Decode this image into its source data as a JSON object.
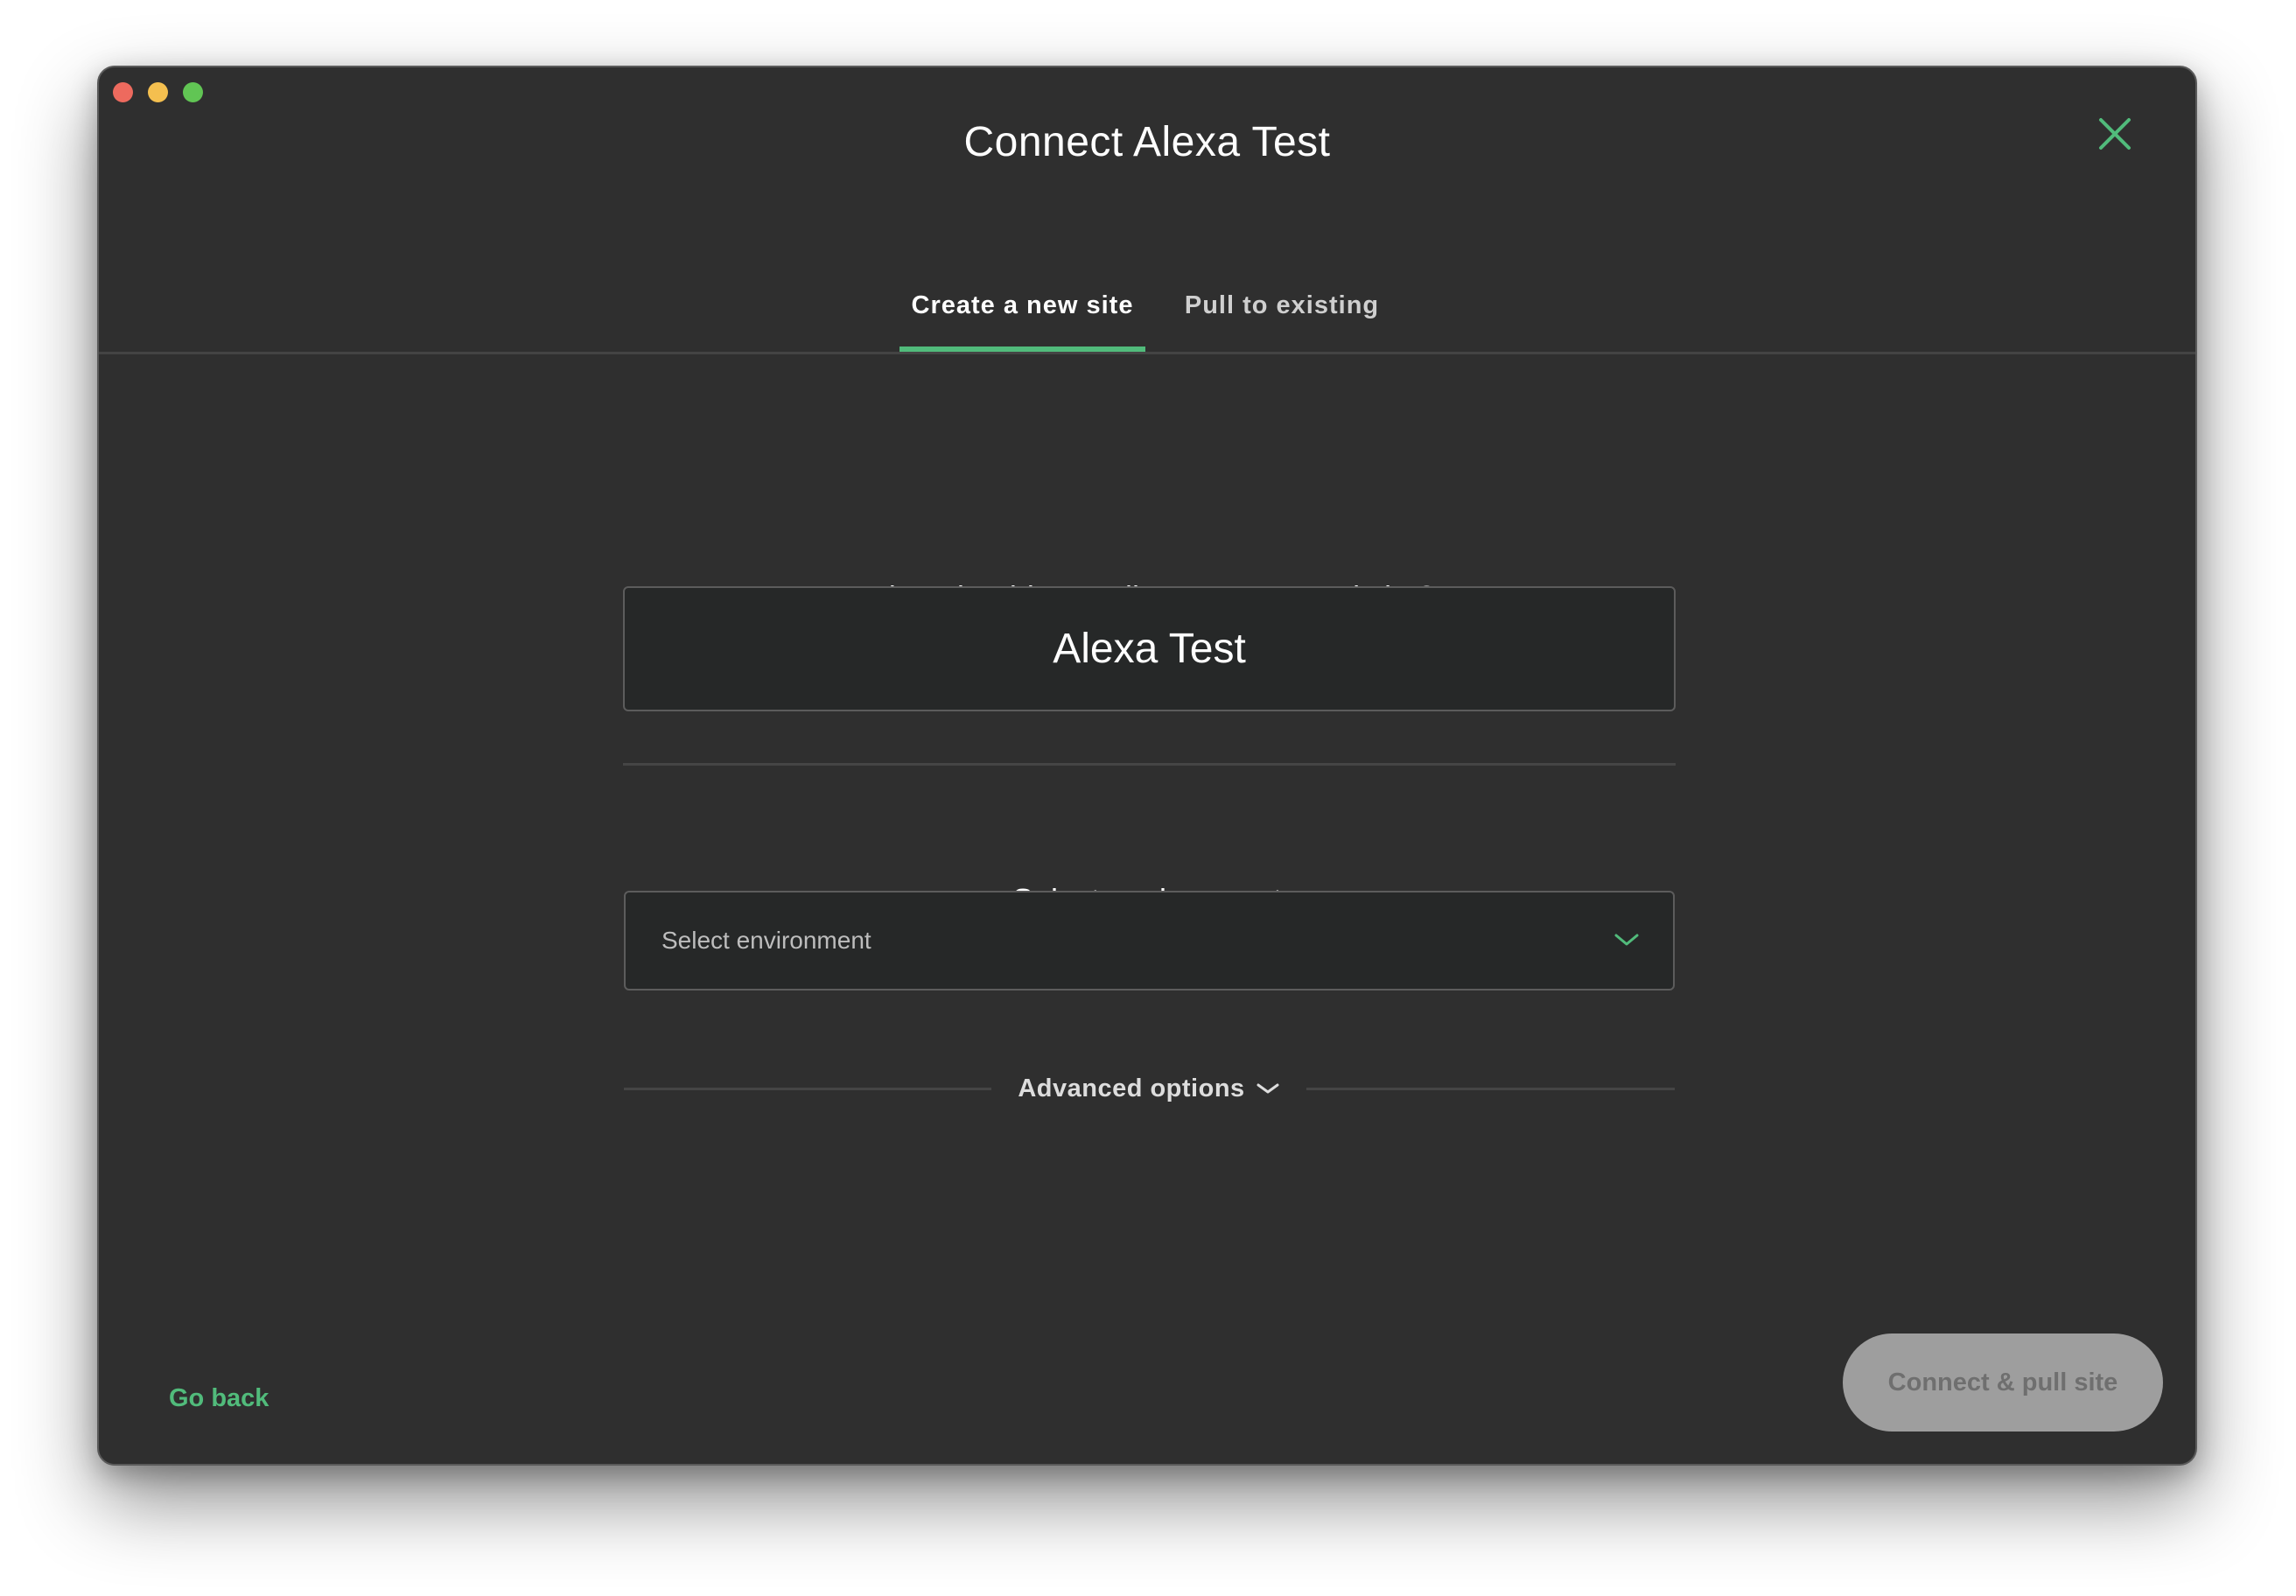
{
  "dialog": {
    "title": "Connect Alexa Test",
    "close_icon": "close-icon",
    "accent_color": "#51bb7b"
  },
  "tabs": [
    {
      "label": "Create a new site",
      "active": true
    },
    {
      "label": "Pull to existing",
      "active": false
    }
  ],
  "form": {
    "site_name_question": "What should we call your new Local site?",
    "site_name_value": "Alexa Test",
    "environment_label": "Select environment",
    "environment_placeholder": "Select environment",
    "environment_icon": "chevron-down-icon",
    "advanced_options_label": "Advanced options"
  },
  "footer": {
    "go_back_label": "Go back",
    "connect_label": "Connect & pull site"
  }
}
